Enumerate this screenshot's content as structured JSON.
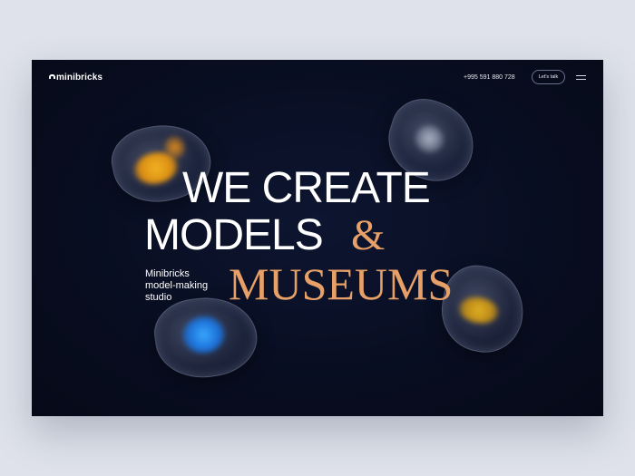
{
  "header": {
    "logo_text": "minibricks",
    "phone": "+995 591 880 728",
    "talk_button": "Let's talk",
    "menu_icon": "hamburger-menu-icon"
  },
  "hero": {
    "line1": "WE CREATE",
    "line2": "MODELS",
    "ampersand": "&",
    "line3": "MUSEUMS",
    "subtitle_lines": [
      "Minibricks",
      "model-making",
      "studio"
    ]
  },
  "colors": {
    "background": "#080d20",
    "accent": "#e7a067",
    "text": "#ffffff"
  }
}
